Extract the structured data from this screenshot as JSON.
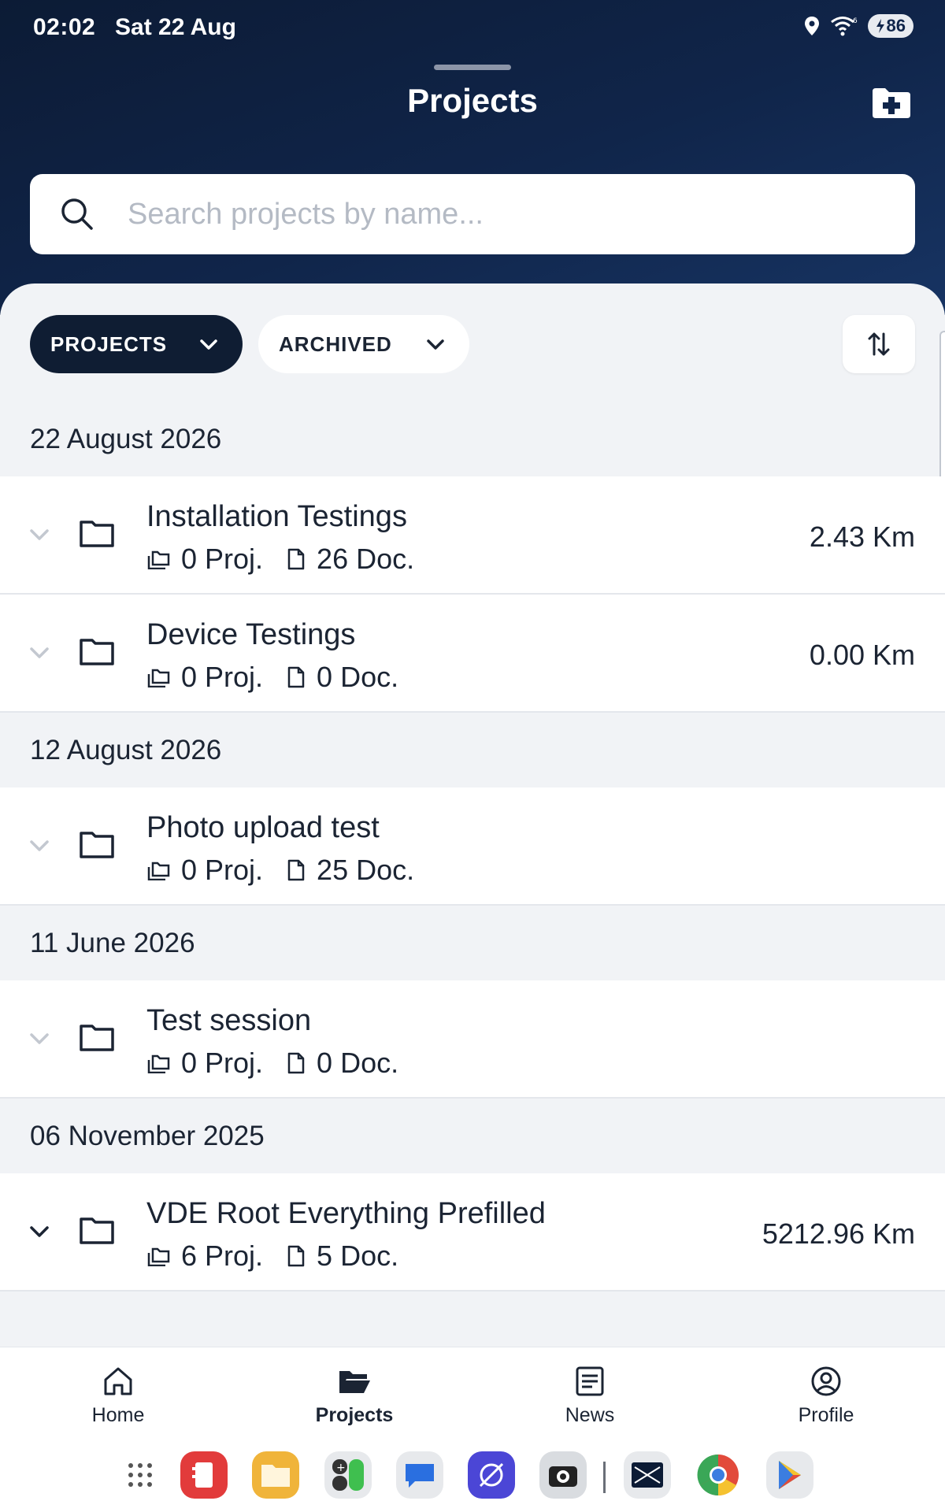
{
  "status_bar": {
    "time": "02:02",
    "date": "Sat 22 Aug",
    "battery": "86"
  },
  "header": {
    "title": "Projects"
  },
  "search": {
    "placeholder": "Search projects by name..."
  },
  "filters": {
    "type_label": "PROJECTS",
    "status_label": "ARCHIVED"
  },
  "groups": [
    {
      "date": "22 August 2026",
      "items": [
        {
          "name": "Installation Testings",
          "projects": "0 Proj.",
          "documents": "26 Doc.",
          "distance": "2.43 Km"
        },
        {
          "name": "Device Testings",
          "projects": "0 Proj.",
          "documents": "0 Doc.",
          "distance": "0.00 Km"
        }
      ]
    },
    {
      "date": "12 August 2026",
      "items": [
        {
          "name": "Photo upload test",
          "projects": "0 Proj.",
          "documents": "25 Doc.",
          "distance": ""
        }
      ]
    },
    {
      "date": "11 June 2026",
      "items": [
        {
          "name": "Test session",
          "projects": "0 Proj.",
          "documents": "0 Doc.",
          "distance": ""
        }
      ]
    },
    {
      "date": "06 November 2025",
      "items": [
        {
          "name": "VDE Root Everything Prefilled",
          "projects": "6 Proj.",
          "documents": "5 Doc.",
          "distance": "5212.96 Km"
        }
      ]
    }
  ],
  "bottom_nav": [
    {
      "label": "Home",
      "icon": "home-icon"
    },
    {
      "label": "Projects",
      "icon": "folder-open-icon",
      "active": true
    },
    {
      "label": "News",
      "icon": "news-icon"
    },
    {
      "label": "Profile",
      "icon": "profile-icon"
    }
  ],
  "colors": {
    "header_dark": "#0c1b35",
    "chip_dark": "#0f1d33",
    "background": "#f1f3f6"
  }
}
